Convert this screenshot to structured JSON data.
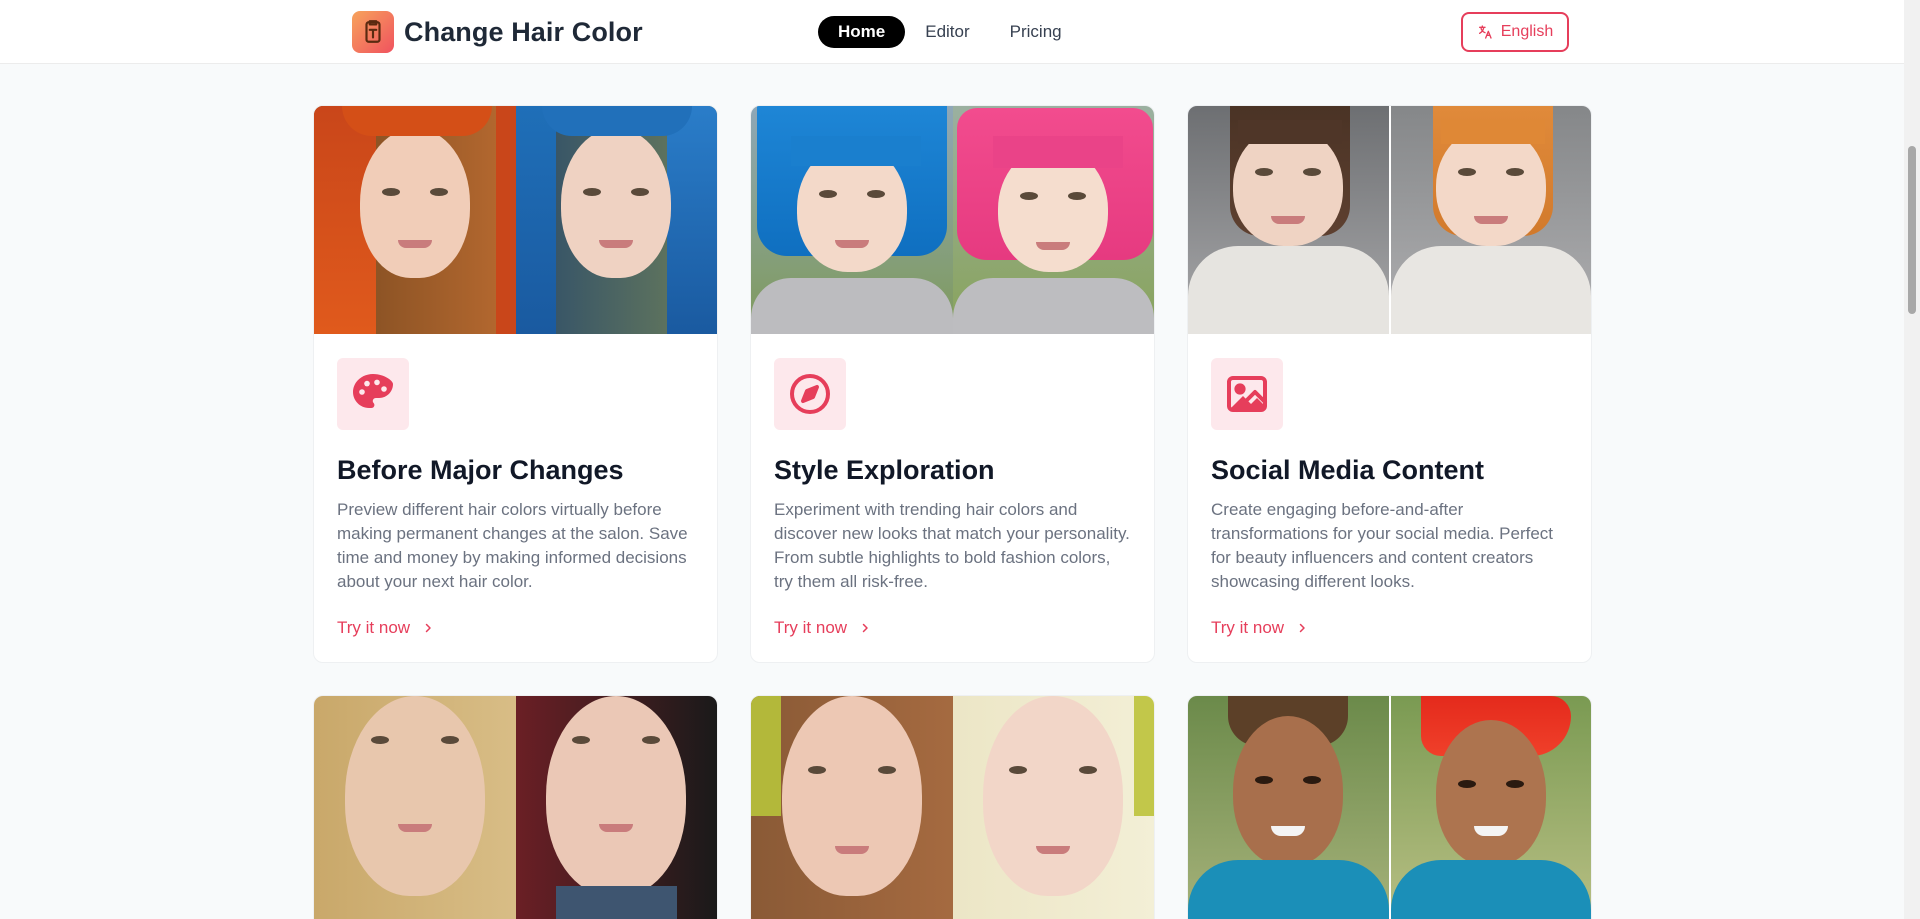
{
  "header": {
    "brand": "Change Hair Color",
    "nav": [
      {
        "label": "Home",
        "active": true
      },
      {
        "label": "Editor",
        "active": false
      },
      {
        "label": "Pricing",
        "active": false
      }
    ],
    "language_label": "English"
  },
  "cards": [
    {
      "icon": "palette-icon",
      "title": "Before Major Changes",
      "description": "Preview different hair colors virtually before making permanent changes at the salon. Save time and money by making informed decisions about your next hair color.",
      "link": "Try it now"
    },
    {
      "icon": "compass-icon",
      "title": "Style Exploration",
      "description": "Experiment with trending hair colors and discover new looks that match your personality. From subtle highlights to bold fashion colors, try them all risk-free.",
      "link": "Try it now"
    },
    {
      "icon": "image-icon",
      "title": "Social Media Content",
      "description": "Create engaging before-and-after transformations for your social media. Perfect for beauty influencers and content creators showcasing different looks.",
      "link": "Try it now"
    }
  ],
  "colors": {
    "accent": "#e63e5b",
    "nav_active_bg": "#000000",
    "icon_box_bg": "#fde8ec"
  }
}
